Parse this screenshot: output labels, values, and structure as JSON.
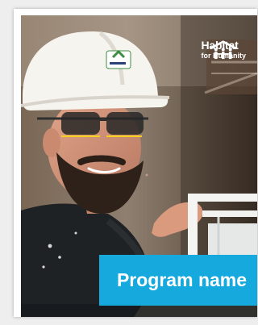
{
  "brand": {
    "name": "Habitat",
    "tagline": "for Humanity",
    "logo_icon": "habitat-house-people-logo"
  },
  "card": {
    "program_name": "Program name"
  },
  "colors": {
    "accent": "#16a9dd",
    "text": "#ffffff"
  }
}
